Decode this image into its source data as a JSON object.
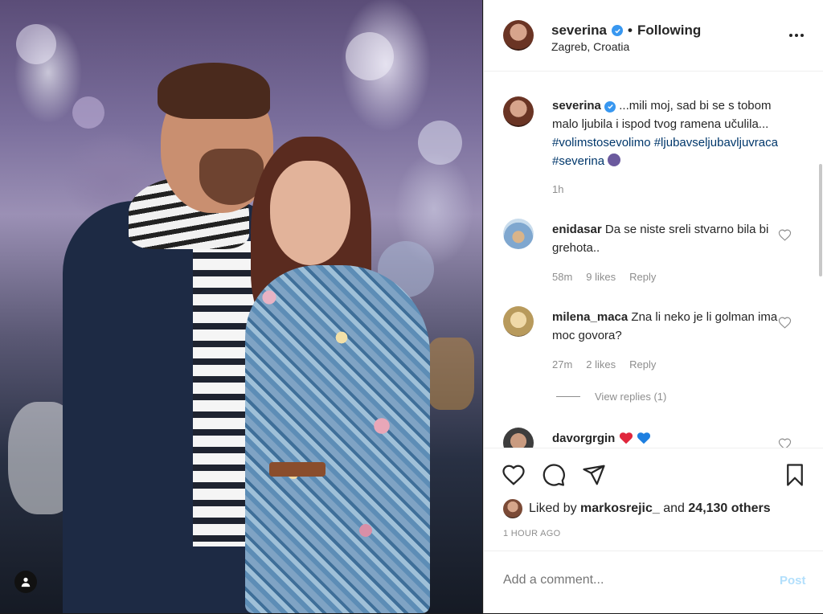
{
  "header": {
    "username": "severina",
    "separator": "•",
    "follow_status": "Following",
    "location": "Zagreb, Croatia"
  },
  "caption": {
    "username": "severina",
    "text": "...mili moj, sad bi se s tobom malo ljubila i ispod tvog ramena učulila...",
    "hashtag1": "#volimstosevolimo",
    "hashtag2": "#ljubavseljubavljuvraca",
    "hashtag3": "#severina",
    "time": "1h"
  },
  "comments": [
    {
      "username": "enidasar",
      "text": "Da se niste sreli stvarno bila bi grehota..",
      "time": "58m",
      "likes": "9 likes",
      "reply": "Reply"
    },
    {
      "username": "milena_maca",
      "text": "Zna li neko je li golman ima moc govora?",
      "time": "27m",
      "likes": "2 likes",
      "reply": "Reply"
    },
    {
      "username": "davorgrgin",
      "text": ""
    }
  ],
  "view_replies": "View replies (1)",
  "likes": {
    "prefix": "Liked by",
    "user": "markosrejic_",
    "middle": "and",
    "count": "24,130 others"
  },
  "time_ago": "1 HOUR AGO",
  "add_comment": {
    "placeholder": "Add a comment...",
    "post_label": "Post"
  },
  "colors": {
    "link": "#00376b",
    "verified": "#3897f0",
    "post_disabled": "#b2dffc"
  }
}
